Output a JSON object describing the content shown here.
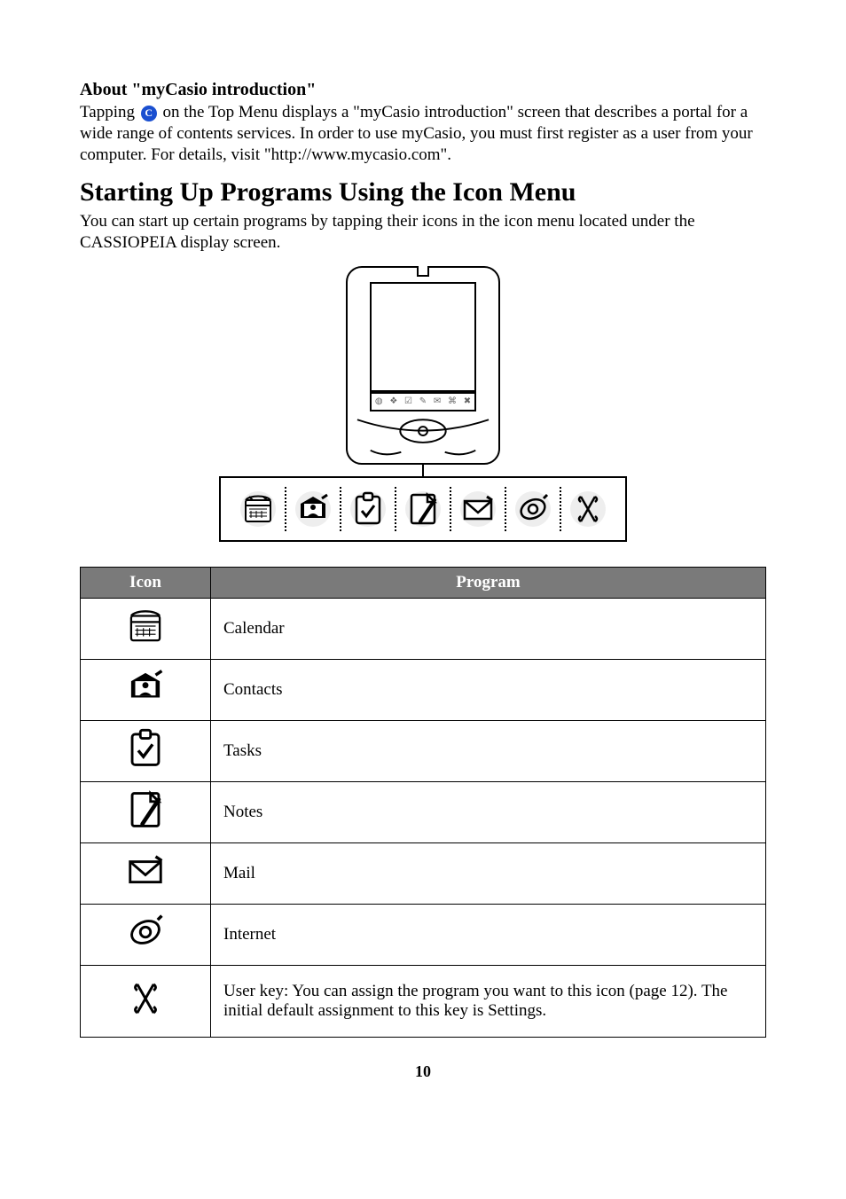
{
  "aboutHeading": "About \"myCasio introduction\"",
  "aboutText1a": "Tapping ",
  "aboutText1b": " on the Top Menu displays a \"myCasio introduction\" screen that describes a portal for a wide range of contents services. In order to use myCasio, you must first register as a user from your computer. For details, visit \"http://www.mycasio.com\".",
  "sectionTitle": "Starting Up Programs Using the Icon Menu",
  "sectionIntro": "You can start up certain programs by tapping their icons in the icon menu located under the CASSIOPEIA display screen.",
  "table": {
    "head": {
      "icon": "Icon",
      "program": "Program"
    },
    "rows": [
      {
        "program": "Calendar"
      },
      {
        "program": "Contacts"
      },
      {
        "program": "Tasks"
      },
      {
        "program": "Notes"
      },
      {
        "program": "Mail"
      },
      {
        "program": "Internet"
      },
      {
        "program": "User key: You can assign the program you want to this icon (page 12). The initial default assignment to this key is Settings."
      }
    ]
  },
  "pageNumber": "10",
  "inlineIconLetter": "C"
}
